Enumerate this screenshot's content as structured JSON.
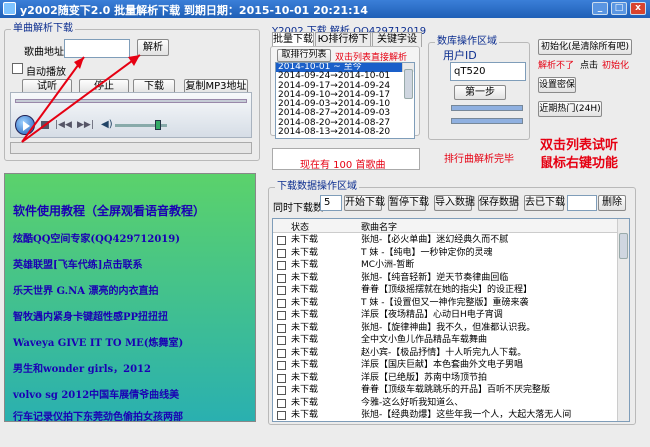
{
  "window": {
    "title": "y2002随变下2.0  批量解析下载    到期日期：2015-10-01 20:21:14",
    "btn_min": "_",
    "btn_max": "□",
    "btn_close": "x"
  },
  "single": {
    "group_label": "单曲解析下载",
    "url_label": "歌曲地址",
    "url_value": "",
    "parse_btn": "解析",
    "autoplay_label": "自动播放",
    "buttons": {
      "audition": "试听",
      "stop": "停止",
      "download": "下载",
      "copy": "复制MP3地址"
    }
  },
  "tabs": {
    "label": "Y2002  下载  解析   QQ429712019",
    "items": [
      "批量下载",
      "Ю排行榜下载",
      "关键字设置"
    ]
  },
  "list": {
    "sub_tab": "取排行列表",
    "hint": "双击列表直接解析",
    "dates": [
      "2014-10-01 ~ 至今",
      "2014-09-24→2014-10-01",
      "2014-09-17→2014-09-24",
      "2014-09-10→2014-09-17",
      "2014-09-03→2014-09-10",
      "2014-08-27→2014-09-03",
      "2014-08-20→2014-08-27",
      "2014-08-13→2014-08-20"
    ],
    "count_text": "现在有 100 首歌曲",
    "parse_done": "排行曲解析完毕"
  },
  "ops": {
    "group_label": "数库操作区域",
    "user_label": "用户ID",
    "user_value": "qT520",
    "step_btn": "第一步",
    "init_btn": "初始化(是清除所有吧)",
    "note1": "解析不了",
    "note2": "点击",
    "note3": "初始化",
    "set_btn": "设置密保",
    "hot_btn": "近期热门(24H)"
  },
  "side_text": {
    "line1": "双击列表试听",
    "line2": "鼠标右键功能"
  },
  "tutorial": {
    "items": [
      "软件使用教程（全屏观看语音教程）",
      "炫酷QQ空间专家(QQ429712019)",
      "英雄联盟[飞车代练]点击联系",
      "乐天世界 G.NA 漂亮的内衣直拍",
      "智牧遇内紧身卡键超性感PP扭扭扭",
      "Waveya GIVE IT TO ME(炼舞室)",
      "男生和wonder girls，2012",
      "volvo sg 2012中国车展倩爷曲线美",
      "行车记录仪拍下东莞劲色偷拍女孩两部"
    ]
  },
  "dl": {
    "group_label": "下载数据操作区域",
    "concurrent_label": "同时下载数",
    "concurrent_value": "5",
    "start_btn": "开始下载",
    "pause_btn": "暂停下载",
    "import_btn": "导入数据",
    "save_btn": "保存数据",
    "dedupe_btn": "去已下载",
    "delete_btn": "删除",
    "col_status": "状态",
    "col_name": "歌曲名字",
    "rows": [
      {
        "status": "未下载",
        "name": "张旭-【必火单曲】迷幻经典久而不腻"
      },
      {
        "status": "未下载",
        "name": "T  妹 -【纯电】一秒钟定你的灵魂"
      },
      {
        "status": "未下载",
        "name": "MC小洲-暂断"
      },
      {
        "status": "未下载",
        "name": "张旭-【纯音轻新】逆天节奏律曲回临"
      },
      {
        "status": "未下载",
        "name": "眷眷【顶级摇摆就在她的指尖】的设正程】"
      },
      {
        "status": "未下载",
        "name": "T  妹 -【设置但又一神作完整版】重磅来袭"
      },
      {
        "status": "未下载",
        "name": "洋辰【夜场精品】心动日H电子宵调"
      },
      {
        "status": "未下载",
        "name": "张旭-【旋律神曲】我不久，但准都认识我。"
      },
      {
        "status": "未下载",
        "name": "全中文小鱼儿作品精品车载舞曲"
      },
      {
        "status": "未下载",
        "name": "赵小宾-【极品抒情】十人听完九人下载。"
      },
      {
        "status": "未下载",
        "name": "洋辰【国庆巨献】本色套曲外文电子男唱"
      },
      {
        "status": "未下载",
        "name": "洋辰【已绝版】苏南中场顶节拍"
      },
      {
        "status": "未下载",
        "name": "眷眷【顶级车载跳跳乐的开品】百听不厌完整版"
      },
      {
        "status": "未下载",
        "name": "今雅-这么好听我知道么、"
      },
      {
        "status": "未下载",
        "name": "张旭-【经典劲爆】这些年我一个人，大起大落无人间"
      }
    ]
  }
}
